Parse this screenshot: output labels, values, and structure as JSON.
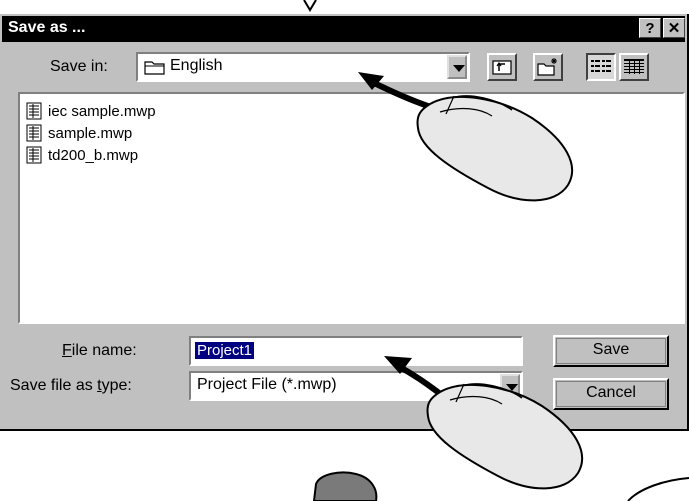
{
  "dialog": {
    "title": "Save as ...",
    "help_button": "?",
    "close_button": "✕"
  },
  "save_in": {
    "label": "Save in:",
    "value": "English"
  },
  "files": [
    {
      "name": "iec sample.mwp"
    },
    {
      "name": "sample.mwp"
    },
    {
      "name": "td200_b.mwp"
    }
  ],
  "file_name": {
    "label_prefix": "",
    "label_underlined": "F",
    "label_rest": "ile name:",
    "value": "Project1"
  },
  "file_type": {
    "label_prefix": "Save file as ",
    "label_underlined": "t",
    "label_rest": "ype:",
    "value": "Project File (*.mwp)"
  },
  "buttons": {
    "save": "Save",
    "cancel": "Cancel"
  },
  "colors": {
    "title_bar": "#000000",
    "dialog_bg": "#c0c0c0",
    "selection": "#000080"
  }
}
